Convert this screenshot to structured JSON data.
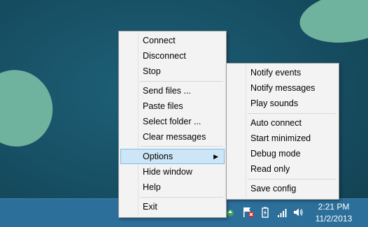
{
  "main_menu": {
    "items": [
      {
        "label": "Connect"
      },
      {
        "label": "Disconnect"
      },
      {
        "label": "Stop"
      },
      {
        "label": "Send files ..."
      },
      {
        "label": "Paste files"
      },
      {
        "label": "Select folder ..."
      },
      {
        "label": "Clear messages"
      },
      {
        "label": "Options",
        "highlighted": true,
        "has_submenu": true
      },
      {
        "label": "Hide window"
      },
      {
        "label": "Help"
      },
      {
        "label": "Exit"
      }
    ]
  },
  "submenu": {
    "items": [
      {
        "label": "Notify events"
      },
      {
        "label": "Notify messages"
      },
      {
        "label": "Play sounds"
      },
      {
        "label": "Auto connect"
      },
      {
        "label": "Start minimized"
      },
      {
        "label": "Debug mode"
      },
      {
        "label": "Read only"
      },
      {
        "label": "Save config"
      }
    ]
  },
  "taskbar": {
    "clock_time": "2:21 PM",
    "clock_date": "11/2/2013",
    "tray_icons": [
      "network-app-icon",
      "action-center-flag-icon",
      "power-icon",
      "signal-bars-icon",
      "speaker-icon"
    ]
  },
  "colors": {
    "desktop": "#1a5468",
    "blob": "#6fb39e",
    "taskbar": "#2c6f9a",
    "highlight_bg": "#cde6f7",
    "highlight_border": "#80bce6"
  }
}
